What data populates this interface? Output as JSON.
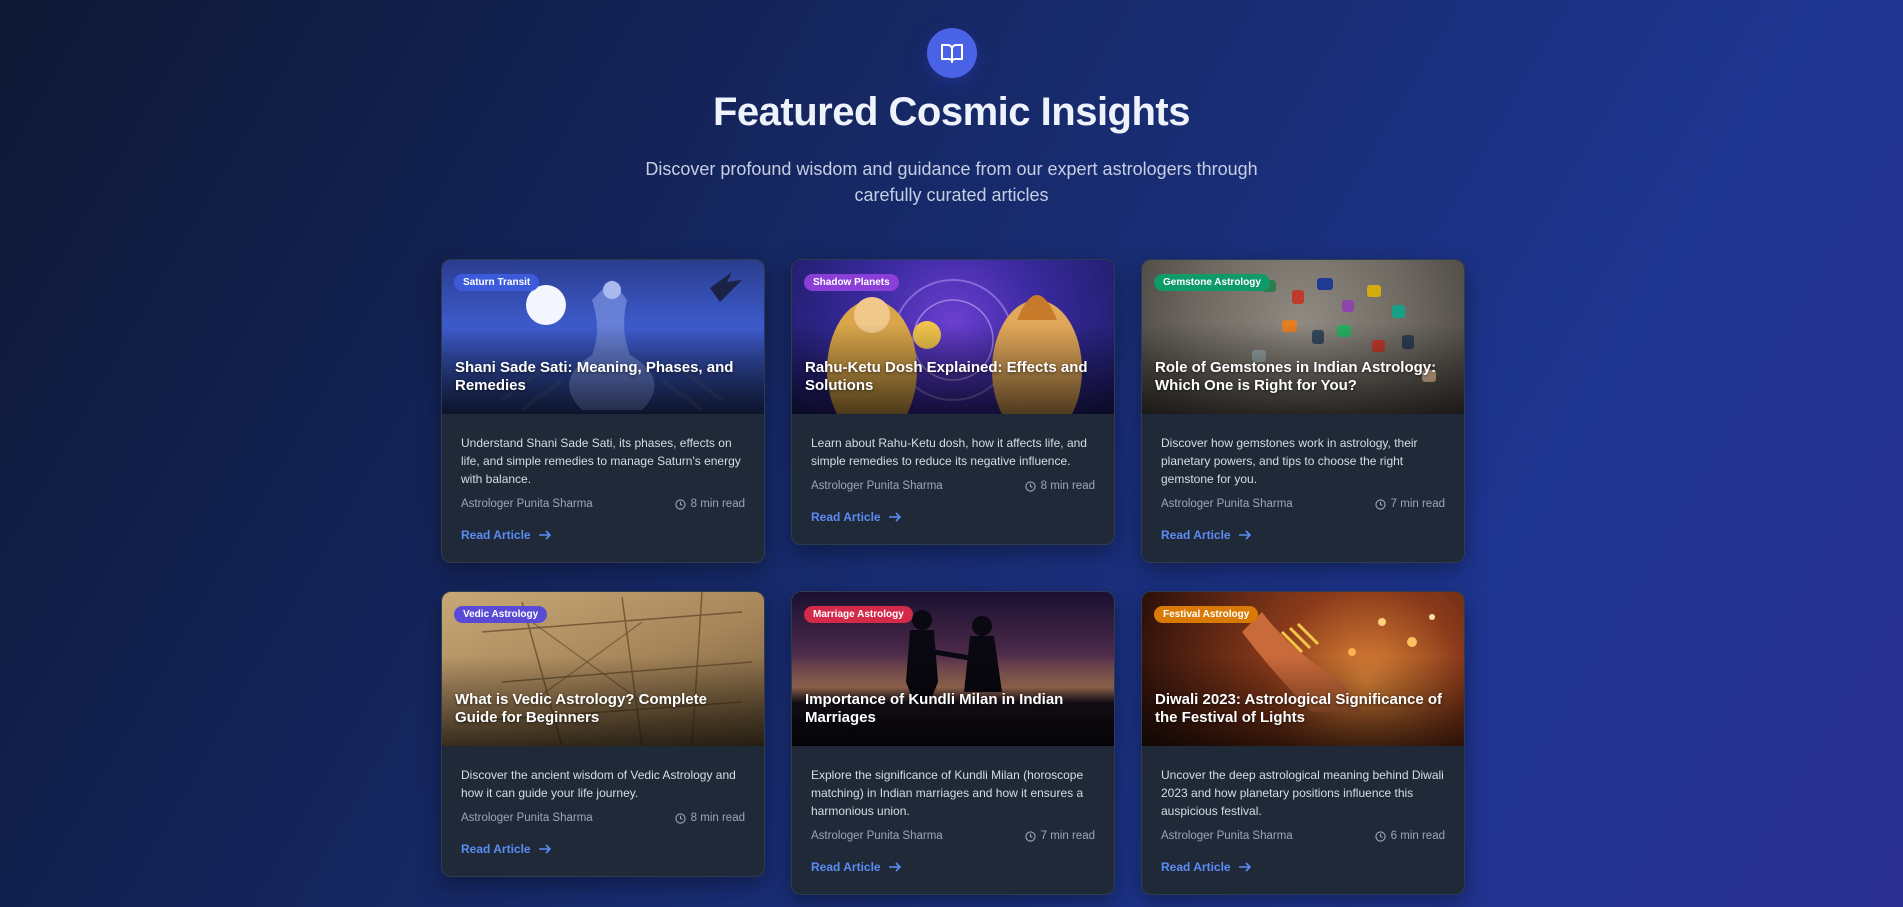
{
  "header": {
    "icon": "book-open-icon",
    "title": "Featured Cosmic Insights",
    "subtitle_line1": "Discover profound wisdom and guidance from our expert astrologers through",
    "subtitle_line2": "carefully curated articles"
  },
  "colors": {
    "accent": "#4a63e6",
    "link": "#5b8cf5",
    "card_bg": "#1f2937"
  },
  "cards": [
    {
      "badge": "Saturn Transit",
      "badge_color": "#3b5bdb",
      "title": "Shani Sade Sati: Meaning, Phases, and Remedies",
      "description": "Understand Shani Sade Sati, its phases, effects on life, and simple remedies to manage Saturn's energy with balance.",
      "author": "Astrologer Punita Sharma",
      "read_time": "8 min read",
      "cta": "Read Article"
    },
    {
      "badge": "Shadow Planets",
      "badge_color": "#8b3fd9",
      "title": "Rahu-Ketu Dosh Explained: Effects and Solutions",
      "description": "Learn about Rahu-Ketu dosh, how it affects life, and simple remedies to reduce its negative influence.",
      "author": "Astrologer Punita Sharma",
      "read_time": "8 min read",
      "cta": "Read Article"
    },
    {
      "badge": "Gemstone Astrology",
      "badge_color": "#0f9a6a",
      "title": "Role of Gemstones in Indian Astrology: Which One is Right for You?",
      "description": "Discover how gemstones work in astrology, their planetary powers, and tips to choose the right gemstone for you.",
      "author": "Astrologer Punita Sharma",
      "read_time": "7 min read",
      "cta": "Read Article"
    },
    {
      "badge": "Vedic Astrology",
      "badge_color": "#5a4bd6",
      "title": "What is Vedic Astrology? Complete Guide for Beginners",
      "description": "Discover the ancient wisdom of Vedic Astrology and how it can guide your life journey.",
      "author": "Astrologer Punita Sharma",
      "read_time": "8 min read",
      "cta": "Read Article"
    },
    {
      "badge": "Marriage Astrology",
      "badge_color": "#d42a4a",
      "title": "Importance of Kundli Milan in Indian Marriages",
      "description": "Explore the significance of Kundli Milan (horoscope matching) in Indian marriages and how it ensures a harmonious union.",
      "author": "Astrologer Punita Sharma",
      "read_time": "7 min read",
      "cta": "Read Article"
    },
    {
      "badge": "Festival Astrology",
      "badge_color": "#d97a06",
      "title": "Diwali 2023: Astrological Significance of the Festival of Lights",
      "description": "Uncover the deep astrological meaning behind Diwali 2023 and how planetary positions influence this auspicious festival.",
      "author": "Astrologer Punita Sharma",
      "read_time": "6 min read",
      "cta": "Read Article"
    }
  ]
}
